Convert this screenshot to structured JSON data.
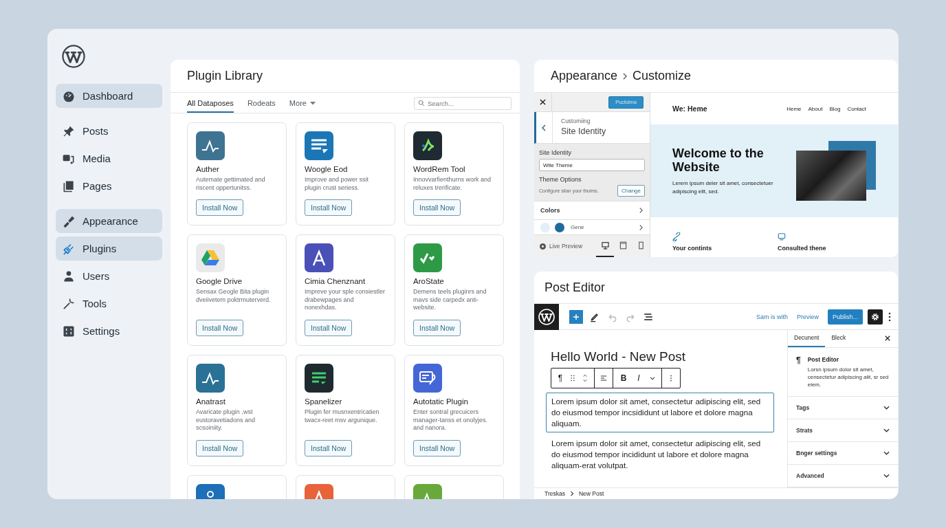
{
  "sidebar": {
    "groups": [
      {
        "items": [
          {
            "label": "Dashboard",
            "highlighted": true,
            "selected": false
          }
        ]
      },
      {
        "items": [
          {
            "label": "Posts",
            "highlighted": false,
            "selected": false
          },
          {
            "label": "Media",
            "highlighted": false,
            "selected": false
          },
          {
            "label": "Pages",
            "highlighted": false,
            "selected": false
          }
        ]
      },
      {
        "items": [
          {
            "label": "Appearance",
            "highlighted": true,
            "selected": false
          },
          {
            "label": "Plugins",
            "highlighted": true,
            "selected": true
          },
          {
            "label": "Users",
            "highlighted": false,
            "selected": false
          },
          {
            "label": "Tools",
            "highlighted": false,
            "selected": false
          },
          {
            "label": "Settings",
            "highlighted": false,
            "selected": false
          }
        ]
      }
    ]
  },
  "plugin_library": {
    "title": "Plugin Library",
    "tabs": [
      {
        "label": "All Dataposes",
        "selected": true,
        "dropdown": false
      },
      {
        "label": "Rodeats",
        "selected": false,
        "dropdown": false
      },
      {
        "label": "More",
        "selected": false,
        "dropdown": true
      }
    ],
    "search": {
      "placeholder": "Search..."
    },
    "plugins": [
      {
        "name": "Auther",
        "description": "Autemate gettimated and riscent oppertunitss.",
        "button": "Install Now",
        "color": "#3e7391"
      },
      {
        "name": "Woogle Eod",
        "description": "Improve and power ssit plugin crust seriess.",
        "button": "Install Now",
        "color": "#1b76b5"
      },
      {
        "name": "WordRem Tool",
        "description": "Innovvarfienthurns work and reluxes trerificate.",
        "button": "Install Now",
        "color": "#1f2a33"
      },
      {
        "name": "Google Drive",
        "description": "Sensax Geogle Bita plugin dveiivetem poktrmuterverd.",
        "button": "Install Now",
        "color": "#eaeaea"
      },
      {
        "name": "Cimia Chenznant",
        "description": "Impreve your sple consiestler drabewpages and nonexhdas.",
        "button": "Install Now",
        "color": "#4a50b8"
      },
      {
        "name": "AroState",
        "description": "Demens teels pluginrs and mavs side carpedx anti-website.",
        "button": "Install Now",
        "color": "#2e9a46"
      },
      {
        "name": "Anatrast",
        "description": "Avaricate plugin ,wst eustoravetiadons and scsoiniity.",
        "button": "Install Now",
        "color": "#2a7196"
      },
      {
        "name": "Spanelizer",
        "description": "Plugin fer musnxentricatien twacx-reet msv argunique.",
        "button": "Install Now",
        "color": "#1f2a30"
      },
      {
        "name": "Autotatic Plugin",
        "description": "Enter sontral grecuicers manager-tanss et onolyjes. and nanora.",
        "button": "Install Now",
        "color": "#4466d6"
      },
      {
        "color": "#1c6fb8"
      },
      {
        "color": "#e8623a"
      },
      {
        "color": "#69a83a"
      }
    ]
  },
  "customize": {
    "breadcrumb": [
      "Appearance",
      "Customize"
    ],
    "publish_button": "Puclidma",
    "section": {
      "eyebrow": "Customiing",
      "title": "Site Identity"
    },
    "site_identity": {
      "label": "Site Identity",
      "value": "Wite Theme"
    },
    "theme_options": {
      "label": "Theme Options",
      "hint": "Configure slian your thuims.",
      "button": "Change"
    },
    "colors": {
      "label": "Colors",
      "swatches": [
        {
          "color": "#e3eef6"
        },
        {
          "color": "#1f6b9c"
        }
      ],
      "swatch_label": "Gene"
    },
    "live_preview": "Live Preview",
    "devices": [
      {
        "kind": "desktop",
        "selected": true
      },
      {
        "kind": "tablet",
        "selected": false
      },
      {
        "kind": "mobile",
        "selected": false
      }
    ],
    "preview": {
      "site_title": "We: Heme",
      "nav": [
        "Heme",
        "About",
        "Blog",
        "Contact"
      ],
      "hero_title": "Welcome to the Website",
      "hero_text": "Lerem ipsum deler sit amet, consectetuer adipiscing ellt, sed.",
      "features": [
        {
          "label": "Your contints"
        },
        {
          "label": "Consulted thene"
        }
      ]
    }
  },
  "post_editor": {
    "title": "Post Editor",
    "tools": [
      {
        "kind": "add",
        "disabled": false
      },
      {
        "kind": "pen",
        "disabled": false
      },
      {
        "kind": "undo",
        "disabled": true
      },
      {
        "kind": "redo",
        "disabled": true
      },
      {
        "kind": "list",
        "disabled": false
      }
    ],
    "links": [
      "Sam is with",
      "Preview"
    ],
    "publish_button": "Publish...",
    "post_title": "Hello World - New Post",
    "block_toolbar": {
      "groups": [
        {
          "items": [
            {
              "kind": "text",
              "label": "¶"
            },
            {
              "kind": "drag"
            },
            {
              "kind": "move"
            }
          ]
        },
        {
          "items": [
            {
              "kind": "align"
            }
          ]
        },
        {
          "items": [
            {
              "kind": "bold",
              "label": "B"
            },
            {
              "kind": "italic",
              "label": "I"
            },
            {
              "kind": "chevron"
            }
          ]
        },
        {
          "items": [
            {
              "kind": "more"
            }
          ]
        }
      ]
    },
    "paragraphs": [
      {
        "text": "Lorem ipsum dolor sit amet, consectetur adipiscing elit, sed do eiusmod tempor incsididunt ut labore et dolore magna aliquam.",
        "selected": true
      },
      {
        "text": "Lorem ipsum dolor sit amet, consectetur adipiscing elit, sed do eiusmod tempor incididunt ut labore et dolore magna aliquam-erat volutpat.",
        "selected": false
      }
    ],
    "sidebar_tabs": [
      {
        "label": "Decunent",
        "selected": true
      },
      {
        "label": "Bleck",
        "selected": false
      }
    ],
    "block_card": {
      "symbol": "¶",
      "title": "Post Editor",
      "description": "Lorsn ipsum dolor sit amet, censectetur adipiscing alit, sr sed eiem."
    },
    "panels": [
      {
        "label": "Tags",
        "expanded": false
      },
      {
        "label": "Strats",
        "expanded": false
      },
      {
        "label": "Bnger settings",
        "expanded": false
      },
      {
        "label": "Advanced",
        "expanded": false
      }
    ],
    "breadcrumb": [
      "Treskas",
      "New Post"
    ]
  }
}
